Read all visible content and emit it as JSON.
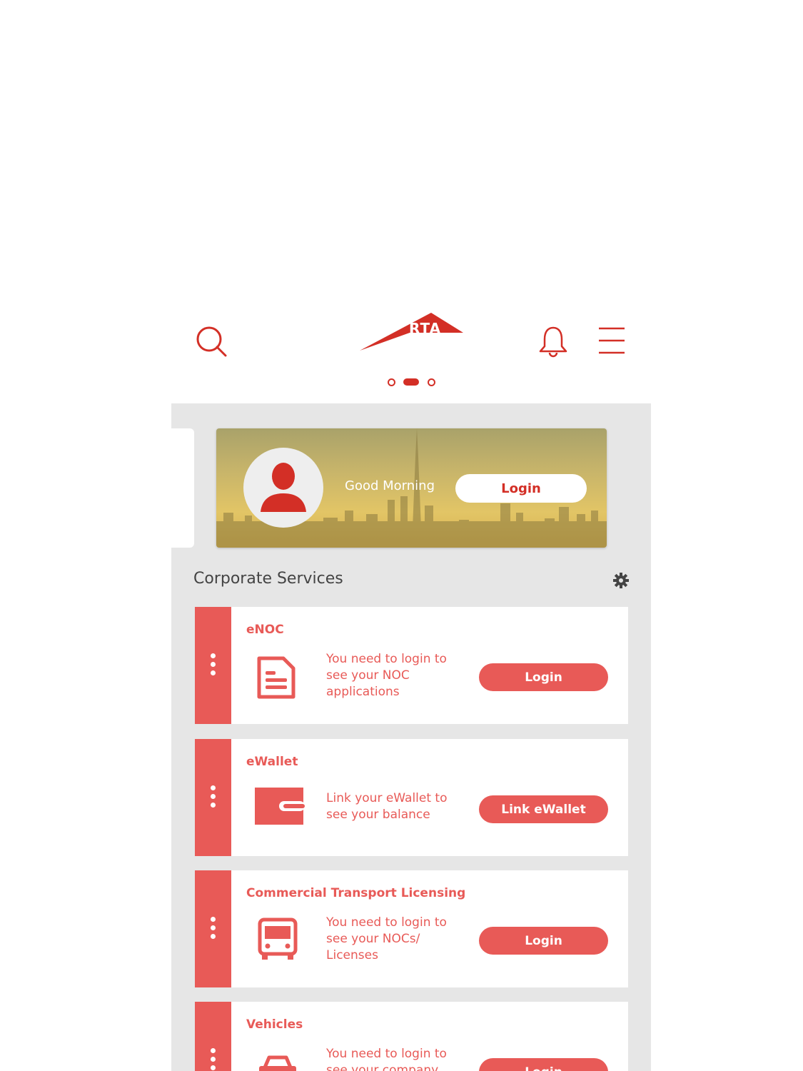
{
  "header": {
    "logo_text": "RTA",
    "icons": {
      "search": "search-icon",
      "logo": "rta-logo",
      "notifications": "bell-icon",
      "menu": "hamburger-menu-icon"
    },
    "page_indicator": {
      "count": 3,
      "active": 1
    }
  },
  "banner": {
    "greeting": "Good Morning",
    "login_label": "Login",
    "avatar_icon": "user-silhouette-icon"
  },
  "section": {
    "title": "Corporate Services",
    "settings_icon": "gear-icon"
  },
  "cards": [
    {
      "title": "eNOC",
      "description": "You need to login to see your NOC applications",
      "button": "Login",
      "icon": "document-icon"
    },
    {
      "title": "eWallet",
      "description": "Link your eWallet to see your balance",
      "button": "Link eWallet",
      "icon": "wallet-icon"
    },
    {
      "title": "Commercial Transport Licensing",
      "description": "You need to login to see your NOCs/ Licenses",
      "button": "Login",
      "icon": "bus-icon"
    },
    {
      "title": "Vehicles",
      "description": "You need to login to see your company",
      "button": "Login",
      "icon": "car-icon"
    }
  ],
  "colors": {
    "brand_red": "#d32f26",
    "card_red": "#e85a57",
    "panel_bg": "#e6e6e6"
  }
}
